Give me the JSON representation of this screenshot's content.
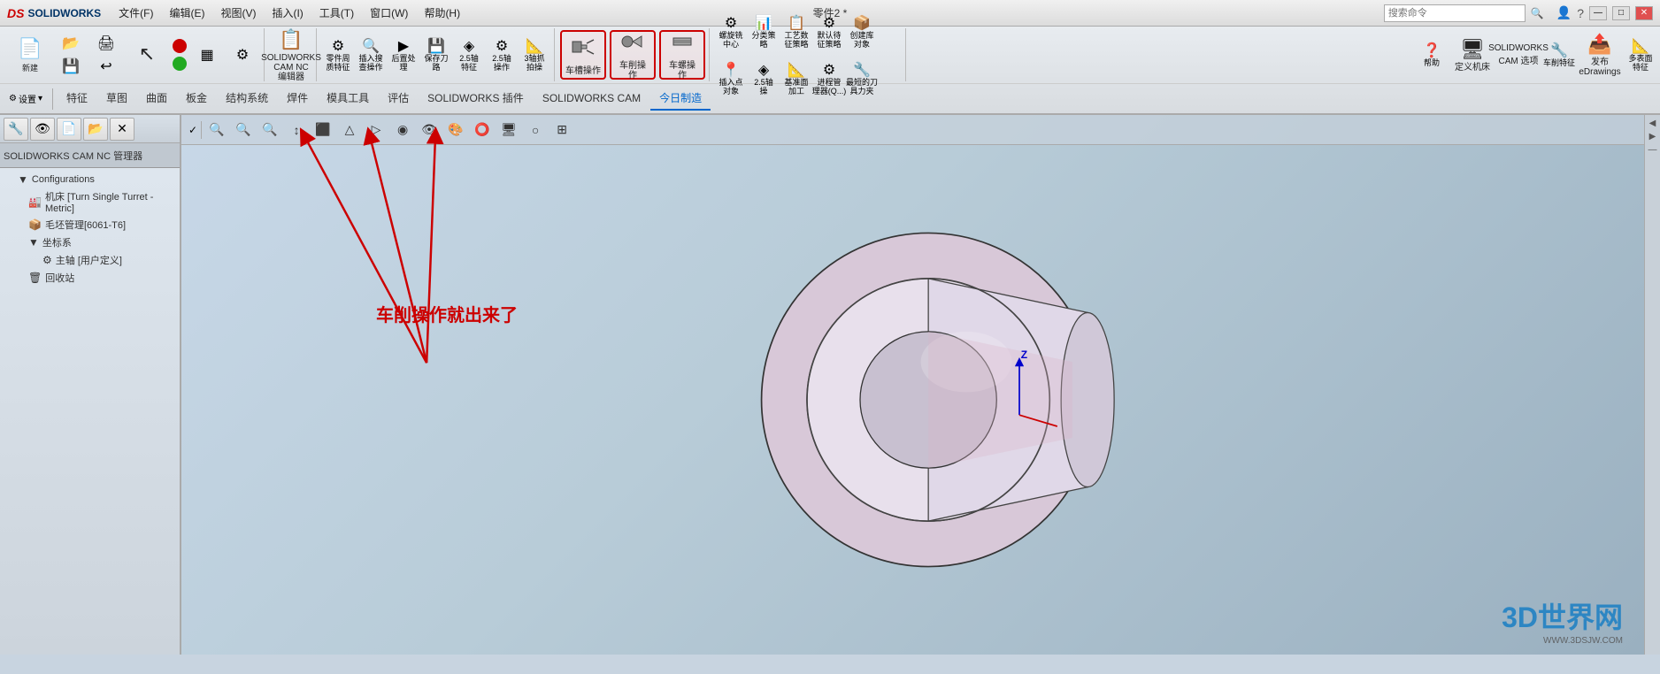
{
  "app": {
    "title": "零件2 *",
    "logo_ds": "DS",
    "logo_sw": "SOLIDWORKS"
  },
  "titlebar": {
    "search_placeholder": "搜索命令",
    "window_title": "零件2 *",
    "min_btn": "—",
    "max_btn": "□",
    "close_btn": "✕",
    "help_btn": "?",
    "user_icon": "👤"
  },
  "menu": {
    "items": [
      "文件(F)",
      "编辑(E)",
      "视图(V)",
      "插入(I)",
      "工具(T)",
      "窗口(W)",
      "帮助(H)"
    ]
  },
  "toolbar": {
    "row1": {
      "sections": [
        {
          "name": "solidworks-cam-editor",
          "buttons": [
            {
              "label": "SOLIDWORKS\nCAM NC\n编辑器",
              "icon": "📋"
            }
          ]
        },
        {
          "name": "operations",
          "buttons": [
            {
              "label": "零件周质特征",
              "icon": "⚙"
            },
            {
              "label": "插入搜查操作",
              "icon": "🔍"
            },
            {
              "label": "后置处理",
              "icon": "▶"
            },
            {
              "label": "保存刀路",
              "icon": "💾"
            },
            {
              "label": "2.5轴特征",
              "icon": "◈"
            },
            {
              "label": "2.5 轴操作",
              "icon": "⚙"
            },
            {
              "label": "3轴抓拍操",
              "icon": "📐"
            }
          ]
        },
        {
          "name": "turn-operations",
          "buttons": [
            {
              "label": "车槽操作",
              "icon": "🔧",
              "highlighted": true
            },
            {
              "label": "车削操作",
              "icon": "🔧",
              "highlighted": true
            },
            {
              "label": "车螺操作",
              "icon": "🔧",
              "highlighted": true
            }
          ]
        },
        {
          "name": "more-operations",
          "buttons": [
            {
              "label": "螺旋铣中心",
              "icon": "⚙"
            },
            {
              "label": "分类策略",
              "icon": "📊"
            },
            {
              "label": "工艺数征策略",
              "icon": "📋"
            },
            {
              "label": "默认待征策略",
              "icon": "⚙"
            },
            {
              "label": "创建库对象",
              "icon": "📦"
            },
            {
              "label": "插入点对象",
              "icon": "📍"
            },
            {
              "label": "2.5轴操",
              "icon": "◈"
            },
            {
              "label": "基准面的加工",
              "icon": "📐"
            },
            {
              "label": "进程管理器(Q...)",
              "icon": "⚙"
            },
            {
              "label": "最短的刀具力夹",
              "icon": "🔧"
            }
          ]
        }
      ],
      "right_buttons": [
        {
          "label": "帮助",
          "icon": "❓"
        },
        {
          "label": "定义机床",
          "icon": "🖥"
        },
        {
          "label": "SOLIDWORKS CAM 选项",
          "icon": "⚙"
        },
        {
          "label": "车削特征",
          "icon": "🔧"
        },
        {
          "label": "发布eDrawings",
          "icon": "📤"
        },
        {
          "label": "多表面特征",
          "icon": "📐"
        }
      ]
    },
    "settings_btn": "设置"
  },
  "tabs": {
    "items": [
      "特征",
      "草图",
      "曲面",
      "板金",
      "结构系统",
      "焊件",
      "模具工具",
      "评估",
      "SOLIDWORKS 插件",
      "SOLIDWORKS CAM",
      "今日制造"
    ],
    "active": "今日制造"
  },
  "left_panel": {
    "title": "SOLIDWORKS CAM NC 管理器",
    "tree": [
      {
        "label": "Configurations",
        "level": 0,
        "icon": "📁"
      },
      {
        "label": "机床 [Turn Single Turret - Metric]",
        "level": 1,
        "icon": "🏭"
      },
      {
        "label": "毛坯管理[6061-T6]",
        "level": 1,
        "icon": "📦"
      },
      {
        "label": "坐标系",
        "level": 1,
        "icon": "📐"
      },
      {
        "label": "主轴 [用户定义]",
        "level": 2,
        "icon": "⚙"
      },
      {
        "label": "回收站",
        "level": 1,
        "icon": "🗑"
      }
    ]
  },
  "viewport": {
    "toolbar_btns": [
      "✓",
      "🔍",
      "🔍",
      "🔍",
      "↕",
      "□",
      "△",
      "▷",
      "◉",
      "👁",
      "🎨",
      "⭕",
      "🖥",
      "○",
      "⊞"
    ],
    "model_color_light": "#f0e8f0",
    "model_color_dark": "#c8b8d0",
    "model_outline": "#222222"
  },
  "annotation": {
    "text": "车削操作就出来了",
    "arrows": [
      {
        "from": "text",
        "to": "button1"
      },
      {
        "from": "text",
        "to": "button2"
      },
      {
        "from": "text",
        "to": "button3"
      }
    ]
  },
  "watermark": {
    "big_text": "3D世界网",
    "url": "WWW.3DSJW.COM"
  }
}
